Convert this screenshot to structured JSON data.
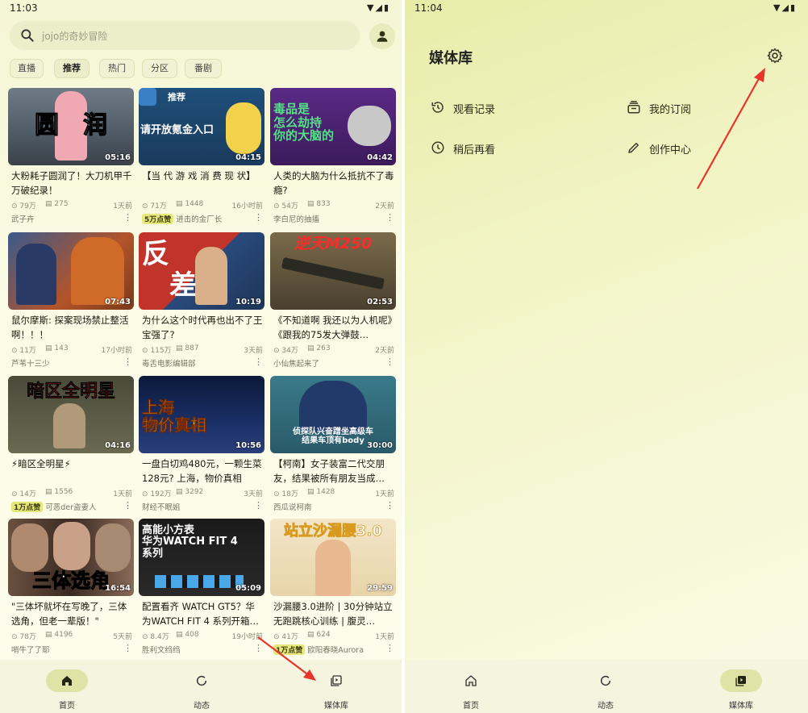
{
  "left_screen": {
    "status_time": "11:03",
    "search": {
      "placeholder": "jojo的奇妙冒险"
    },
    "tabs": [
      {
        "label": "直播"
      },
      {
        "label": "推荐"
      },
      {
        "label": "热门"
      },
      {
        "label": "分区"
      },
      {
        "label": "番剧"
      }
    ],
    "videos": [
      {
        "thumb_text": "圆　润",
        "duration": "05:16",
        "title": "大粉耗子圆润了！大刀机甲千万破纪录！",
        "views": "79万",
        "danmaku": "275",
        "time": "1天前",
        "badge": "",
        "author": "武子卉"
      },
      {
        "thumb_text": "请开放氪金入口",
        "thumb_label": "推荐",
        "duration": "04:15",
        "title": "【当 代 游 戏 消 费 现 状】",
        "views": "71万",
        "danmaku": "1448",
        "time": "16小时前",
        "badge": "5万点赞",
        "author": "进击的金厂长"
      },
      {
        "thumb_text": "毒品是\n怎么劫持\n你的大脑的",
        "duration": "04:42",
        "title": "人类的大脑为什么抵抗不了毒瘾?",
        "views": "54万",
        "danmaku": "833",
        "time": "2天前",
        "badge": "",
        "author": "李白尼的抽搐"
      },
      {
        "thumb_text": "",
        "duration": "07:43",
        "title": "鼠尔摩斯: 探案现场禁止整活啊！！！",
        "views": "11万",
        "danmaku": "143",
        "time": "17小时前",
        "badge": "",
        "author": "芦苇十三少"
      },
      {
        "thumb_text": "反\n　差",
        "duration": "10:19",
        "title": "为什么这个时代再也出不了王宝强了?",
        "views": "115万",
        "danmaku": "887",
        "time": "3天前",
        "badge": "",
        "author": "毒舌电影编辑部"
      },
      {
        "thumb_text": "逆天M250",
        "duration": "02:53",
        "title": "《不知道啊 我还以为人机呢》《跟我的75发大弹鼓…",
        "views": "34万",
        "danmaku": "263",
        "time": "2天前",
        "badge": "",
        "author": "小仙焦起来了"
      },
      {
        "thumb_text": "暗区全明星",
        "duration": "04:16",
        "title": "⚡暗区全明星⚡",
        "views": "14万",
        "danmaku": "1556",
        "time": "1天前",
        "badge": "1万点赞",
        "author": "可恶der盗妻人"
      },
      {
        "thumb_text": "上海\n物价真相",
        "duration": "10:56",
        "title": "一盘白切鸡480元，一颗生菜128元? 上海，物价真相",
        "views": "192万",
        "danmaku": "3292",
        "time": "3天前",
        "badge": "",
        "author": "财经不眠姐"
      },
      {
        "thumb_text": "侦探队兴奋蹭坐高级车\n结果车顶有body",
        "duration": "30:00",
        "title": "【柯南】女子装富二代交朋友，结果被所有朋友当成…",
        "views": "18万",
        "danmaku": "1428",
        "time": "1天前",
        "badge": "",
        "author": "西瓜说柯南"
      },
      {
        "thumb_text": "三体选角",
        "duration": "16:54",
        "title": "\"三体坏就坏在写晚了，三体选角，但老一辈版！\"",
        "views": "78万",
        "danmaku": "4196",
        "time": "5天前",
        "badge": "",
        "author": "哨牛了了耶"
      },
      {
        "thumb_text": "高能小方表\n华为WATCH FIT 4\n系列",
        "duration": "05:09",
        "title": "配置看齐 WATCH GT5？华为WATCH FIT 4 系列开箱…",
        "views": "8.4万",
        "danmaku": "408",
        "time": "19小时前",
        "badge": "",
        "author": "胜利文绉绉"
      },
      {
        "thumb_text": "站立沙漏腰3.0",
        "duration": "29:59",
        "title": "沙漏腰3.0进阶 | 30分钟站立无跑跳核心训练 | 腹灵…",
        "views": "41万",
        "danmaku": "624",
        "time": "1天前",
        "badge": "1万点赞",
        "author": "欧阳春晓Aurora"
      }
    ],
    "nav": [
      {
        "label": "首页",
        "icon": "home-icon"
      },
      {
        "label": "动态",
        "icon": "activity-icon"
      },
      {
        "label": "媒体库",
        "icon": "library-icon"
      }
    ]
  },
  "right_screen": {
    "status_time": "11:04",
    "heading": "媒体库",
    "menu": [
      {
        "label": "观看记录",
        "icon": "history-icon"
      },
      {
        "label": "我的订阅",
        "icon": "subscription-icon"
      },
      {
        "label": "稍后再看",
        "icon": "clock-icon"
      },
      {
        "label": "创作中心",
        "icon": "pencil-icon"
      }
    ],
    "nav": [
      {
        "label": "首页",
        "icon": "home-icon"
      },
      {
        "label": "动态",
        "icon": "activity-icon"
      },
      {
        "label": "媒体库",
        "icon": "library-icon"
      }
    ]
  },
  "colors": {
    "accent_pill": "#dfe4a6",
    "annotation_arrow": "#e8352a",
    "badge": "#e6e97a"
  }
}
